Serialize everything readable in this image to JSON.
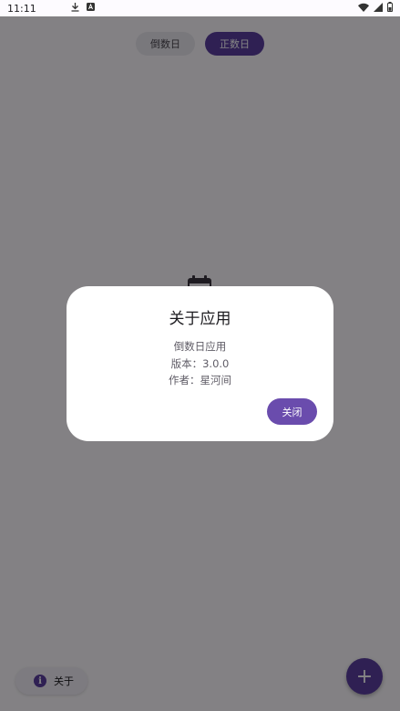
{
  "status_bar": {
    "time": "11:11",
    "icons": [
      "download-icon",
      "a-icon"
    ],
    "right_icons": [
      "wifi-icon",
      "signal-icon",
      "battery-icon"
    ]
  },
  "segmented": {
    "countdown_label": "倒数日",
    "countup_label": "正数日",
    "selected": "countup"
  },
  "main": {
    "center_icon": "calendar-icon"
  },
  "bottom": {
    "about_label": "关于",
    "fab_symbol": "+"
  },
  "dialog": {
    "title": "关于应用",
    "app_name": "倒数日应用",
    "version": "版本：3.0.0",
    "author": "作者：星河间",
    "close_label": "关闭"
  },
  "colors": {
    "accent": "#5b3fa0",
    "scrim": "rgba(0,0,0,0.48)",
    "dialog_bg": "#ffffff"
  }
}
